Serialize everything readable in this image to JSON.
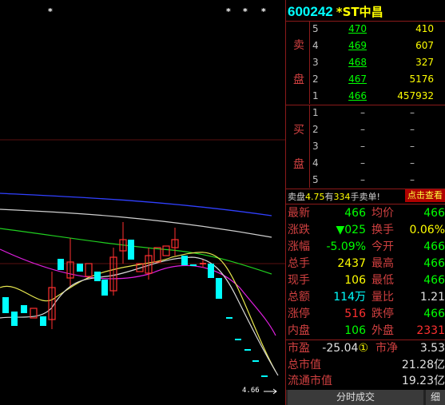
{
  "stock": {
    "code": "600242",
    "name": "*ST中昌"
  },
  "chart": {
    "price_marker": "4.66",
    "marker_stars": [
      "*",
      "*",
      "*",
      "*"
    ]
  },
  "order_book": {
    "sell_label": [
      "卖",
      "盘"
    ],
    "buy_label": [
      "买",
      "盘"
    ],
    "sell": [
      {
        "level": "5",
        "price": "470",
        "volume": "410"
      },
      {
        "level": "4",
        "price": "469",
        "volume": "607"
      },
      {
        "level": "3",
        "price": "468",
        "volume": "327"
      },
      {
        "level": "2",
        "price": "467",
        "volume": "5176"
      },
      {
        "level": "1",
        "price": "466",
        "volume": "457932"
      }
    ],
    "buy": [
      {
        "level": "1",
        "price": "–",
        "volume": "–"
      },
      {
        "level": "2",
        "price": "–",
        "volume": "–"
      },
      {
        "level": "3",
        "price": "–",
        "volume": "–"
      },
      {
        "level": "4",
        "price": "–",
        "volume": "–"
      },
      {
        "level": "5",
        "price": "–",
        "volume": "–"
      }
    ]
  },
  "notice": {
    "prefix": "卖盘",
    "price": "4.75",
    "mid": "有",
    "qty": "334",
    "suffix": "手卖单!",
    "button": "点击查看"
  },
  "quotes": [
    {
      "k1": "最新",
      "v1": "466",
      "c1": "green",
      "k2": "均价",
      "v2": "466",
      "c2": "green"
    },
    {
      "k1": "涨跌",
      "v1": "▼025",
      "c1": "green",
      "k2": "换手",
      "v2": "0.06%",
      "c2": "yellow"
    },
    {
      "k1": "涨幅",
      "v1": "-5.09%",
      "c1": "green",
      "k2": "今开",
      "v2": "466",
      "c2": "green"
    },
    {
      "k1": "总手",
      "v1": "2437",
      "c1": "yellow",
      "k2": "最高",
      "v2": "466",
      "c2": "green"
    },
    {
      "k1": "现手",
      "v1": "106",
      "c1": "yellow",
      "k2": "最低",
      "v2": "466",
      "c2": "green"
    },
    {
      "k1": "总额",
      "v1": "114万",
      "c1": "cyan",
      "k2": "量比",
      "v2": "1.21",
      "c2": "white"
    },
    {
      "k1": "涨停",
      "v1": "516",
      "c1": "red",
      "k2": "跌停",
      "v2": "466",
      "c2": "green"
    },
    {
      "k1": "内盘",
      "v1": "106",
      "c1": "green",
      "k2": "外盘",
      "v2": "2331",
      "c2": "red"
    }
  ],
  "valuation": {
    "pe_label": "市盈",
    "pe_value": "-25.04",
    "pe_badge": "①",
    "pb_label": "市净",
    "pb_value": "3.53",
    "total_cap_label": "总市值",
    "total_cap_value": "21.28亿",
    "float_cap_label": "流通市值",
    "float_cap_value": "19.23亿"
  },
  "tabs": {
    "main": "分时成交",
    "detail": "细"
  },
  "colors": {
    "up": "#ff3030",
    "down": "#00ff00",
    "border": "#8b1a1a"
  }
}
